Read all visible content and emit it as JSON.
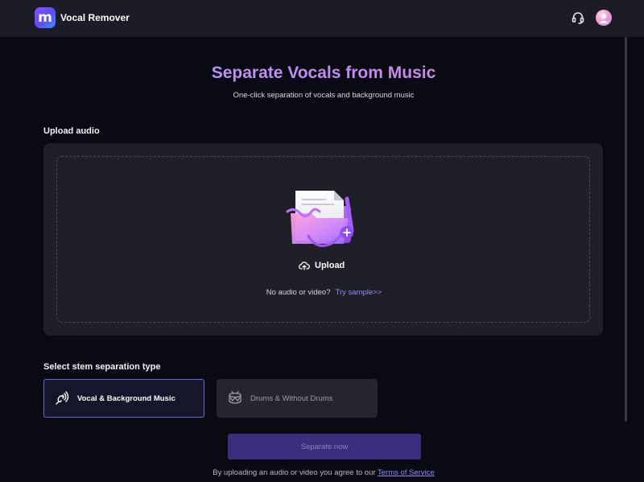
{
  "header": {
    "logo_letter": "m",
    "app_title": "Vocal Remover",
    "support_icon": "headset-icon",
    "avatar_icon": "user-avatar-icon"
  },
  "hero": {
    "title": "Separate Vocals from Music",
    "subtitle": "One-click separation of vocals and background music"
  },
  "upload": {
    "section_label": "Upload audio",
    "illustration": "folder-music-icon",
    "upload_icon": "cloud-upload-icon",
    "button_label": "Upload",
    "no_audio_text": "No audio or video?",
    "try_sample_link": "Try sample>>"
  },
  "stem": {
    "section_label": "Select stem separation type",
    "options": [
      {
        "label": "Vocal & Background Music",
        "icon": "vocal-wave-icon",
        "selected": true
      },
      {
        "label": "Drums & Without Drums",
        "icon": "drum-icon",
        "selected": false
      }
    ]
  },
  "actions": {
    "separate_label": "Separate now",
    "terms_text": "By uploading an audio or video you agree to our",
    "terms_link": "Terms of Service"
  },
  "colors": {
    "accent": "#6b63d8",
    "link": "#8b8dff",
    "background": "#0a0a12",
    "card": "#1f1f28",
    "button_disabled": "#3a2f7c"
  }
}
